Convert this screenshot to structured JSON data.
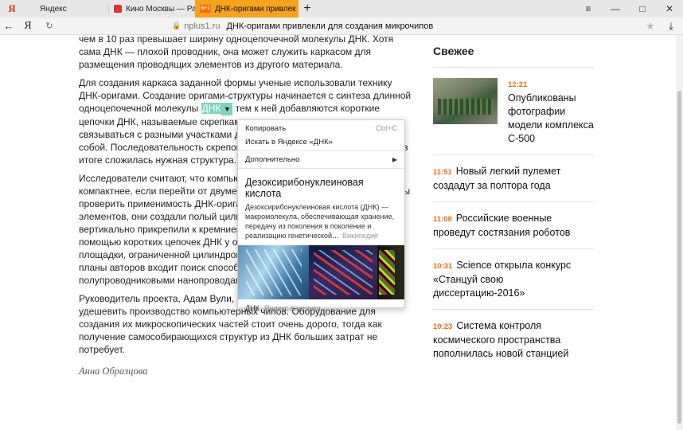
{
  "tabs": [
    {
      "label": "Яндекс"
    },
    {
      "label": "Кино Москвы — Расписан"
    },
    {
      "label": "ДНК-оригами привлек",
      "favicon": "N+1"
    }
  ],
  "browser": {
    "logo": "Я",
    "window_controls": {
      "menu": "≡",
      "minimize": "—",
      "maximize": "□",
      "close": "✕"
    },
    "new_tab": "+"
  },
  "address": {
    "back": "←",
    "ya": "Я",
    "reload": "↻",
    "domain": "nplus1.ru",
    "title": "ДНК-оригами привлекли для создания микрочипов",
    "star": "★",
    "download": "⤓"
  },
  "article": {
    "p1": "чем в 10 раз превышает ширину одноцепочечной молекулы ДНК. Хотя сама ДНК — плохой проводник, она может служить каркасом для размещения проводящих элементов из другого материала.",
    "p2_before": "Для создания каркаса заданной формы ученые использовали технику ДНК-оригами. Создание оригами-структуры начинается с синтеза длинной одноцепочечной молекулы ",
    "p2_highlight": "ДНК",
    "p2_after": " тем к ней добавляются короткие цепочки ДНК, называемые скрепками, которые могут комплементарно связываться с разными участками длинной цепи и сшивая их между собой. Последовательность скрепок подбирается таким образом, чтобы в итоге сложилась нужная структура.",
    "p3": "Исследователи считают, что компьютерные чипы можно сделать компактнее, если перейти от двумерных к трехмерным структурам. Чтобы проверить применимость ДНК-оригами для создания трехмерных элементов, они создали полый цилиндр из ДНК-оригами, который вертикально прикрепили к кремниевой подложке. Это было сделано с помощью коротких цепочек ДНК у основания цилиндра и на поверхности площадки, ограниченной цилиндром. Ученые отмечают, что дальнейшие планы авторов входит поиск способа металлизации и полупроводниковыми нанопроводами.",
    "p4": "Руководитель проекта, Адам Вули, считает, что ДНК может сильно удешевить производство компьютерных чипов. Оборудование для создания их микроскопических частей стоит очень дорого, тогда как получение самособирающихся структур из ДНК больших затрат не потребует.",
    "author": "Анна Образцова"
  },
  "sidebar": {
    "heading": "Свежее",
    "items": [
      {
        "time": "12:21",
        "text": "Опубликованы фотографии модели комплекса С-500"
      },
      {
        "time": "11:51",
        "text": "Новый легкий пулемет создадут за полтора года"
      },
      {
        "time": "11:08",
        "text": "Российские военные проведут состязания роботов"
      },
      {
        "time": "10:31",
        "text": "Science открыла конкурс «Станцуй свою диссертацию-2016»"
      },
      {
        "time": "10:23",
        "text": "Система контроля космического пространства пополнилась новой станцией"
      }
    ]
  },
  "context_menu": {
    "copy": "Копировать",
    "copy_shortcut": "Ctrl+C",
    "search": "Искать в Яндексе «ДНК»",
    "more": "Дополнительно",
    "def_title": "Дезоксирибонуклеиновая кислота",
    "def_body": "Дезоксирибонуклеиновая кислота (ДНК) — макромолекула, обеспечивающая хранение, передачу из поколения в поколение и реализацию генетической…",
    "def_source": "Википедия",
    "img_query": "ДНК",
    "img_source": "Яндекс.Картинки"
  }
}
